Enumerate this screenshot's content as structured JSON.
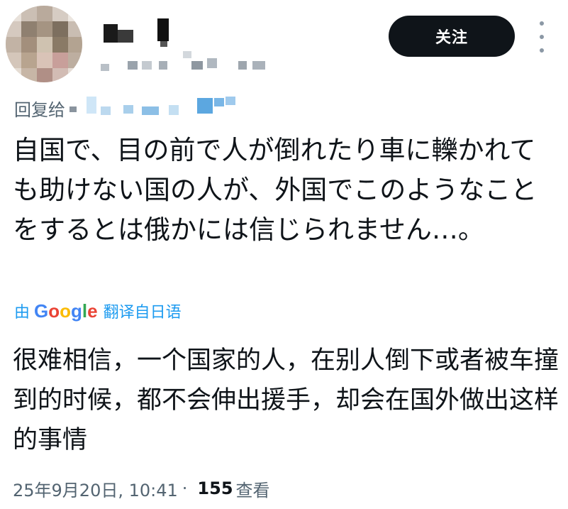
{
  "header": {
    "follow_label": "关注"
  },
  "reply": {
    "label": "回复给"
  },
  "post": {
    "original_text": "自国で、目の前で人が倒れたり車に轢かれても助けない国の人が、外国でこのようなことをするとは俄かには信じられません…。",
    "translate_prefix": "由",
    "translate_suffix": "翻译自日语",
    "translated_text": "很难相信，一个国家的人，在别人倒下或者被车撞到的时候，都不会伸出援手，却会在国外做出这样的事情"
  },
  "meta": {
    "timestamp": "25年9月20日, 10:41",
    "separator": "·",
    "view_count": "155",
    "views_label": "查看"
  },
  "icons": {
    "more": "more-vertical-icon",
    "logo": "google-logo"
  },
  "colors": {
    "follow_bg": "#0f1419",
    "link": "#1d9bf0",
    "secondary_text": "#536471"
  }
}
